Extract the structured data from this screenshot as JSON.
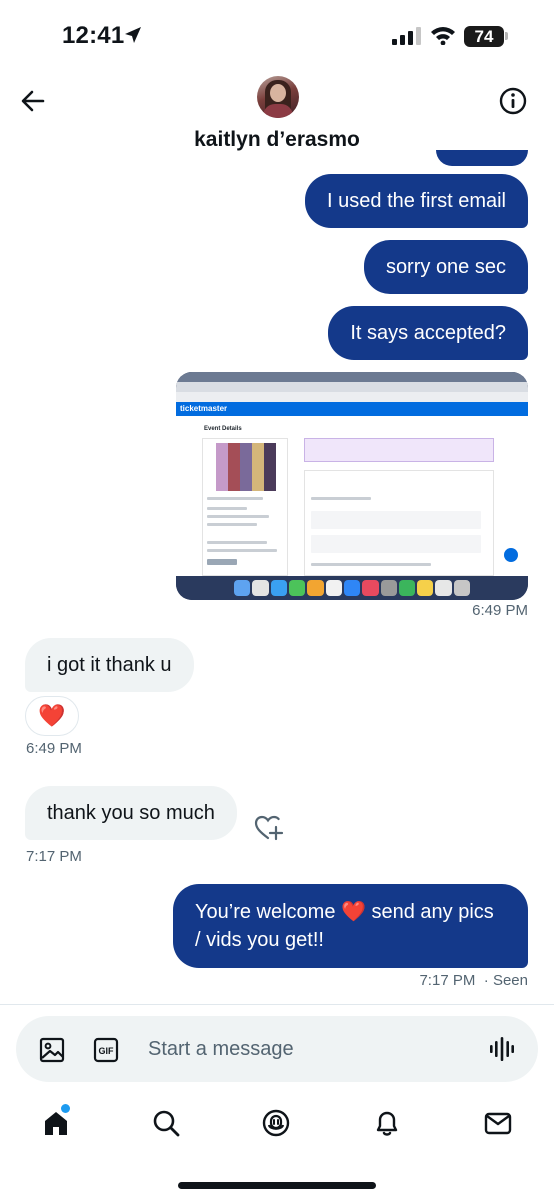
{
  "status_bar": {
    "time": "12:41",
    "battery": "74"
  },
  "header": {
    "contact_name": "kaitlyn d’erasmo"
  },
  "messages": [
    {
      "text": "I used the first email"
    },
    {
      "text": "sorry one sec"
    },
    {
      "text": "It says accepted?"
    },
    {
      "attachment": "screenshot",
      "timestamp": "6:49 PM"
    },
    {
      "text": "i got it thank u",
      "reaction": "❤️",
      "timestamp": "6:49 PM"
    },
    {
      "text": "thank you so much",
      "timestamp": "7:17 PM"
    },
    {
      "text_line1": "You’re welcome ❤️ send any pics",
      "text_line2": "/ vids you get!!",
      "timestamp": "7:17 PM",
      "status": "· Seen"
    }
  ],
  "attachment": {
    "brand": "ticketmaster",
    "page_title": "Event Details"
  },
  "composer": {
    "placeholder": "Start a message"
  },
  "icons": {
    "back": "arrow-left-icon",
    "info": "info-icon",
    "image": "image-icon",
    "gif": "gif-icon",
    "voice": "voice-icon",
    "add_reaction": "heart-plus-icon",
    "tabs": [
      "home-icon",
      "search-icon",
      "spaces-icon",
      "notifications-icon",
      "messages-icon"
    ]
  },
  "colors": {
    "outgoing_bubble": "#14398a",
    "incoming_bubble": "#eff3f4",
    "accent_dot": "#1d9bf0"
  }
}
